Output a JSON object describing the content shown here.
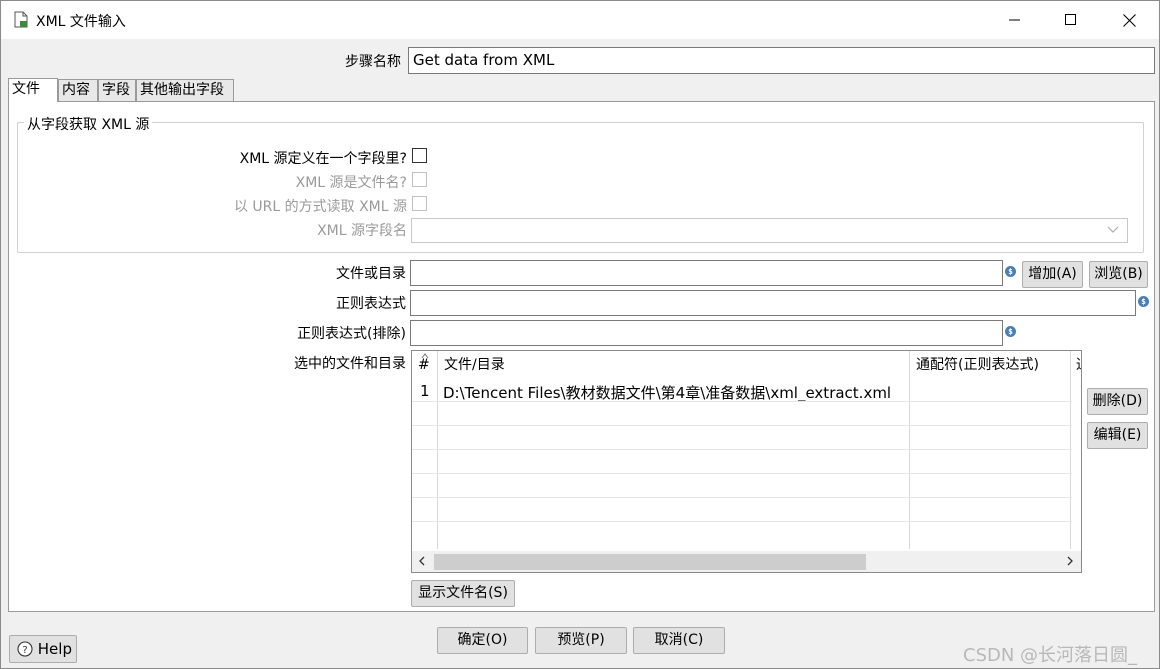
{
  "window": {
    "title": "XML 文件输入",
    "controls": [
      "minimize-icon",
      "maximize-icon",
      "close-icon"
    ]
  },
  "step": {
    "label": "步骤名称",
    "value": "Get data from XML"
  },
  "tabs": [
    {
      "label": "文件",
      "active": true
    },
    {
      "label": "内容",
      "active": false
    },
    {
      "label": "字段",
      "active": false
    },
    {
      "label": "其他输出字段",
      "active": false
    }
  ],
  "source_group": {
    "title": "从字段获取 XML 源",
    "defined_in_field_label": "XML 源定义在一个字段里?",
    "is_filename_label": "XML 源是文件名?",
    "read_as_url_label": "以 URL 的方式读取 XML 源",
    "field_name_label": "XML 源字段名",
    "field_name_value": ""
  },
  "file": {
    "file_or_dir_label": "文件或目录",
    "file_or_dir_value": "",
    "regex_label": "正则表达式",
    "regex_value": "",
    "regex_exclude_label": "正则表达式(排除)",
    "regex_exclude_value": "",
    "add_button": "增加(A)",
    "browse_button": "浏览(B)",
    "selected_label": "选中的文件和目录",
    "delete_button": "删除(D)",
    "edit_button": "编辑(E)",
    "show_filenames_button": "显示文件名(S)"
  },
  "table": {
    "headers": [
      "#",
      "文件/目录",
      "通配符(正则表达式)",
      "通"
    ],
    "rows": [
      {
        "num": "1",
        "path": "D:\\Tencent Files\\教材数据文件\\第4章\\准备数据\\xml_extract.xml",
        "wildcard": ""
      }
    ],
    "scroll_left_icon": "<",
    "scroll_right_icon": ">"
  },
  "footer": {
    "help": "Help",
    "ok": "确定(O)",
    "preview": "预览(P)",
    "cancel": "取消(C)"
  },
  "watermark": "CSDN @长河落日圆_",
  "colors": {
    "accent_icon": "#4a7fb6",
    "panel_bg": "#ffffff",
    "window_bg": "#f0f0f0"
  }
}
